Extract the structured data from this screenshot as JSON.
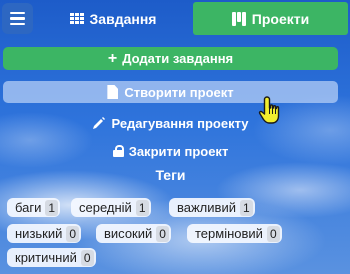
{
  "header": {
    "tabs": [
      {
        "label": "Завдання",
        "icon": "grid-icon",
        "active": false
      },
      {
        "label": "Проекти",
        "icon": "columns-icon",
        "active": true
      }
    ]
  },
  "actions": {
    "add_task": "Додати завдання",
    "create_project": "Створити проект",
    "edit_project": "Редагування проекту",
    "close_project": "Закрити проект"
  },
  "tags": {
    "heading": "Теги",
    "items": [
      {
        "label": "баги",
        "count": "1"
      },
      {
        "label": "середній",
        "count": "1"
      },
      {
        "label": "важливий",
        "count": "1"
      },
      {
        "label": "низький",
        "count": "0"
      },
      {
        "label": "високий",
        "count": "0"
      },
      {
        "label": "терміновий",
        "count": "0"
      },
      {
        "label": "критичний",
        "count": "0"
      }
    ]
  },
  "colors": {
    "accent_green": "#3cb564",
    "background_blue": "#2f74dc"
  }
}
